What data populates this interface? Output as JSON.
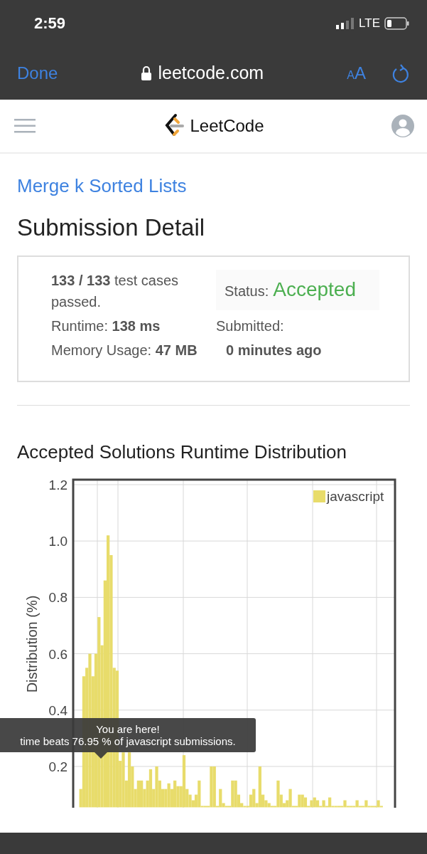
{
  "status_bar": {
    "time": "2:59",
    "network": "LTE"
  },
  "browser_bar": {
    "done": "Done",
    "url": "leetcode.com",
    "text_size": {
      "small": "A",
      "large": "A"
    }
  },
  "header": {
    "logo_text": "LeetCode"
  },
  "problem_link": "Merge k Sorted Lists",
  "page_title": "Submission Detail",
  "summary": {
    "cases": "133 / 133",
    "cases_text": "test cases passed.",
    "status_label": "Status:",
    "status": "Accepted",
    "runtime_label": "Runtime:",
    "runtime": "138 ms",
    "submitted_label": "Submitted:",
    "memory_label": "Memory Usage:",
    "memory": "47 MB",
    "submitted": "0 minutes ago"
  },
  "distribution": {
    "title": "Accepted Solutions Runtime Distribution",
    "chart_data": {
      "type": "bar",
      "ylabel": "Distribution (%)",
      "grid": true,
      "ylim": [
        0.055,
        1.2
      ],
      "yticks": [
        {
          "value": 0.2,
          "label": "0.2"
        },
        {
          "value": 0.4,
          "label": "0.4"
        },
        {
          "value": 0.6,
          "label": "0.6"
        },
        {
          "value": 0.8,
          "label": "0.8"
        },
        {
          "value": 1,
          "label": "1.0"
        },
        {
          "value": 1.2,
          "label": "1.2"
        }
      ],
      "series": [
        {
          "name": "javascript",
          "color": "#e8dc6b",
          "values": [
            null,
            null,
            0.12,
            0.52,
            0.55,
            0.6,
            0.52,
            0.6,
            0.73,
            0.63,
            0.86,
            1.02,
            0.95,
            0.55,
            0.54,
            0.22,
            0.25,
            0.15,
            0.25,
            0.2,
            0.12,
            0.15,
            0.15,
            0.12,
            0.15,
            0.19,
            0.12,
            0.2,
            0.15,
            0.12,
            0.12,
            0.14,
            0.12,
            0.15,
            0.13,
            0.13,
            0.24,
            0.12,
            0.1,
            0.08,
            0.1,
            0.15,
            0.06,
            0.06,
            0.06,
            0.2,
            0.2,
            0.06,
            0.12,
            0.07,
            0.06,
            0.06,
            0.15,
            0.15,
            0.1,
            0.07,
            0.06,
            0.06,
            0.1,
            0.12,
            0.07,
            0.2,
            0.1,
            0.08,
            0.07,
            0.06,
            0.06,
            0.15,
            0.1,
            0.07,
            0.08,
            0.12,
            0.06,
            0.06,
            0.1,
            0.1,
            0.09,
            0.06,
            0.08,
            0.09,
            0.08,
            0.06,
            0.08,
            0.06,
            0.09,
            0.06,
            0.06,
            0.06,
            0.06,
            0.08,
            0.06,
            0.06,
            0.06,
            0.08,
            0.06,
            0.06,
            0.08,
            0.06,
            0.06,
            0.06,
            0.08,
            0.06,
            null,
            null,
            null,
            null
          ]
        }
      ]
    },
    "tooltip": {
      "title": "You are here!",
      "text": "time beats 76.95 % of javascript submissions."
    }
  }
}
